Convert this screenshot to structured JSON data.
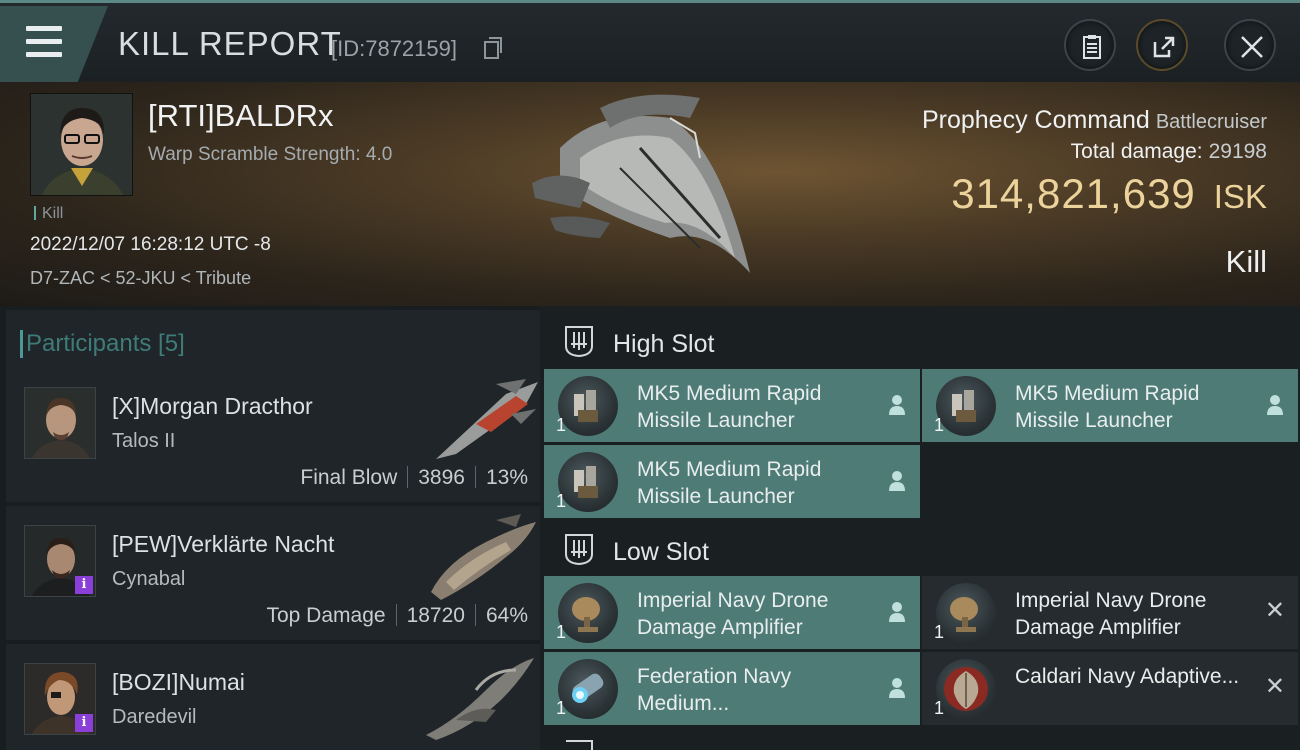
{
  "titlebar": {
    "title": "KILL REPORT",
    "report_id": "[ID:7872159]"
  },
  "victim": {
    "name": "[RTI]BALDRx",
    "warp_scramble": "Warp Scramble Strength: 4.0",
    "kill_tag": "Kill",
    "datetime": "2022/12/07 16:28:12 UTC -8",
    "location": "D7-ZAC < 52-JKU < Tribute",
    "ship_name": "Prophecy Command",
    "ship_class": "Battlecruiser",
    "total_damage_label": "Total damage:",
    "total_damage_value": "29198",
    "isk_value": "314,821,639",
    "isk_unit": "ISK",
    "result": "Kill"
  },
  "participants": {
    "label": "Participants [5]",
    "items": [
      {
        "name": "[X]Morgan Dracthor",
        "ship": "Talos II",
        "stat_label": "Final Blow",
        "damage": "3896",
        "percent": "13%"
      },
      {
        "name": "[PEW]Verklärte Nacht",
        "ship": "Cynabal",
        "stat_label": "Top Damage",
        "damage": "18720",
        "percent": "64%"
      },
      {
        "name": "[BOZI]Numai",
        "ship": "Daredevil"
      }
    ]
  },
  "fitting": {
    "high_slot": {
      "label": "High Slot",
      "modules": [
        {
          "name": "MK5 Medium Rapid Missile Launcher",
          "qty": "1"
        },
        {
          "name": "MK5 Medium Rapid Missile Launcher",
          "qty": "1"
        },
        {
          "name": "MK5 Medium Rapid Missile Launcher",
          "qty": "1"
        }
      ]
    },
    "low_slot": {
      "label": "Low Slot",
      "modules": [
        {
          "name": "Imperial Navy Drone Damage Amplifier",
          "qty": "1"
        },
        {
          "name": "Imperial Navy Drone Damage Amplifier",
          "qty": "1"
        },
        {
          "name": "Federation Navy Medium...",
          "qty": "1"
        },
        {
          "name": "Caldari Navy Adaptive...",
          "qty": "1"
        }
      ]
    }
  },
  "icons": {
    "menu": "hamburger-icon",
    "copy": "copy-icon",
    "report": "clipboard-icon",
    "share": "share-icon",
    "close": "close-icon",
    "pilot": "pilot-icon",
    "destroyed": "x-icon",
    "slot": "slot-icon"
  },
  "colors": {
    "accent_teal": "#4e7b76",
    "isk_gold": "#ecd29b",
    "participants_teal": "#3f7c79",
    "badge_purple": "#8b3fd9"
  }
}
